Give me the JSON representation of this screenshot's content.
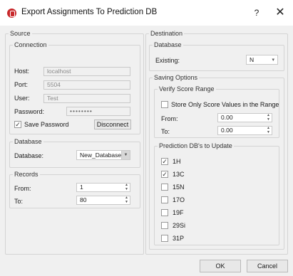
{
  "window": {
    "title": "Export Assignments To Prediction DB",
    "help_label": "?",
    "close_label": "✕"
  },
  "source": {
    "legend": "Source",
    "connection": {
      "legend": "Connection",
      "host_label": "Host:",
      "host_value": "localhost",
      "port_label": "Port:",
      "port_value": "5504",
      "user_label": "User:",
      "user_value": "Test",
      "password_label": "Password:",
      "password_value": "••••••••",
      "save_password_label": "Save Password",
      "save_password_checked": true,
      "disconnect_label": "Disconnect"
    },
    "database": {
      "legend": "Database",
      "label": "Database:",
      "value": "New_Database"
    },
    "records": {
      "legend": "Records",
      "from_label": "From:",
      "from_value": "1",
      "to_label": "To:",
      "to_value": "80"
    }
  },
  "destination": {
    "legend": "Destination",
    "database": {
      "legend": "Database",
      "existing_label": "Existing:",
      "existing_value": "N"
    },
    "saving_options": {
      "legend": "Saving Options",
      "verify": {
        "legend": "Verify Score Range",
        "store_only_label": "Store Only Score Values in the Range",
        "store_only_checked": false,
        "from_label": "From:",
        "from_value": "0.00",
        "to_label": "To:",
        "to_value": "0.00"
      },
      "prediction": {
        "legend": "Prediction DB's to Update",
        "items": [
          {
            "label": "1H",
            "checked": true
          },
          {
            "label": "13C",
            "checked": true
          },
          {
            "label": "15N",
            "checked": false
          },
          {
            "label": "17O",
            "checked": false
          },
          {
            "label": "19F",
            "checked": false
          },
          {
            "label": "29Si",
            "checked": false
          },
          {
            "label": "31P",
            "checked": false
          }
        ]
      }
    }
  },
  "footer": {
    "ok_label": "OK",
    "cancel_label": "Cancel"
  },
  "icons": {
    "app": "app-logo-icon",
    "spin": "spin-arrows-icon",
    "dropdown": "chevron-down-icon",
    "check": "checkmark-icon"
  }
}
